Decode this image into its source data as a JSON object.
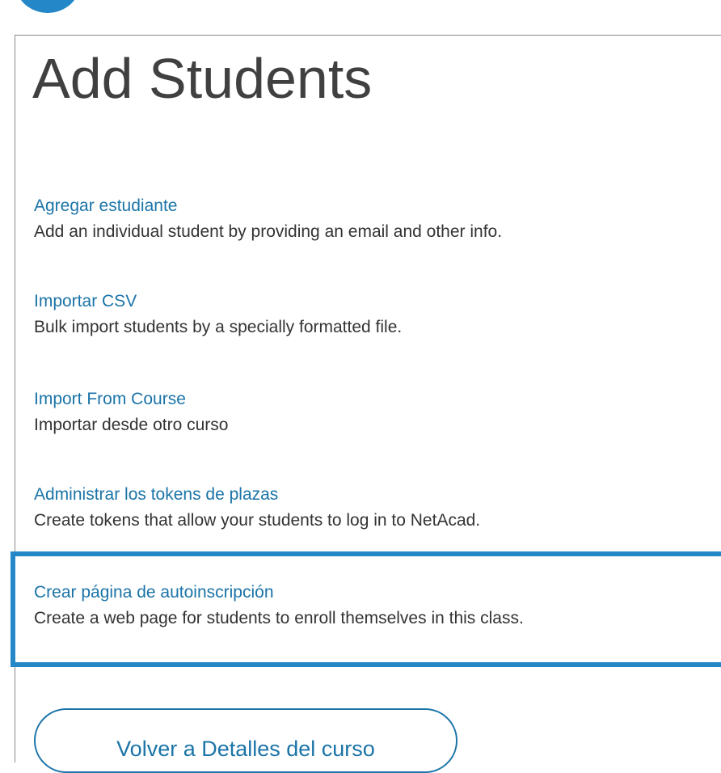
{
  "page": {
    "title": "Add Students"
  },
  "options": [
    {
      "link": "Agregar estudiante",
      "description": "Add an individual student by providing an email and other info."
    },
    {
      "link": "Importar CSV",
      "description": "Bulk import students by a specially formatted file."
    },
    {
      "link": "Import From Course",
      "description": "Importar desde otro curso"
    },
    {
      "link": "Administrar los tokens de plazas",
      "description": "Create tokens that allow your students to log in to NetAcad."
    },
    {
      "link": "Crear página de autoinscripción",
      "description": "Create a web page for students to enroll themselves in this class.",
      "highlighted": true
    }
  ],
  "back_button": {
    "label": "Volver a Detalles del curso"
  },
  "colors": {
    "accent": "#2387c8",
    "link": "#1b74a8",
    "title": "#404040",
    "text": "#333333"
  }
}
